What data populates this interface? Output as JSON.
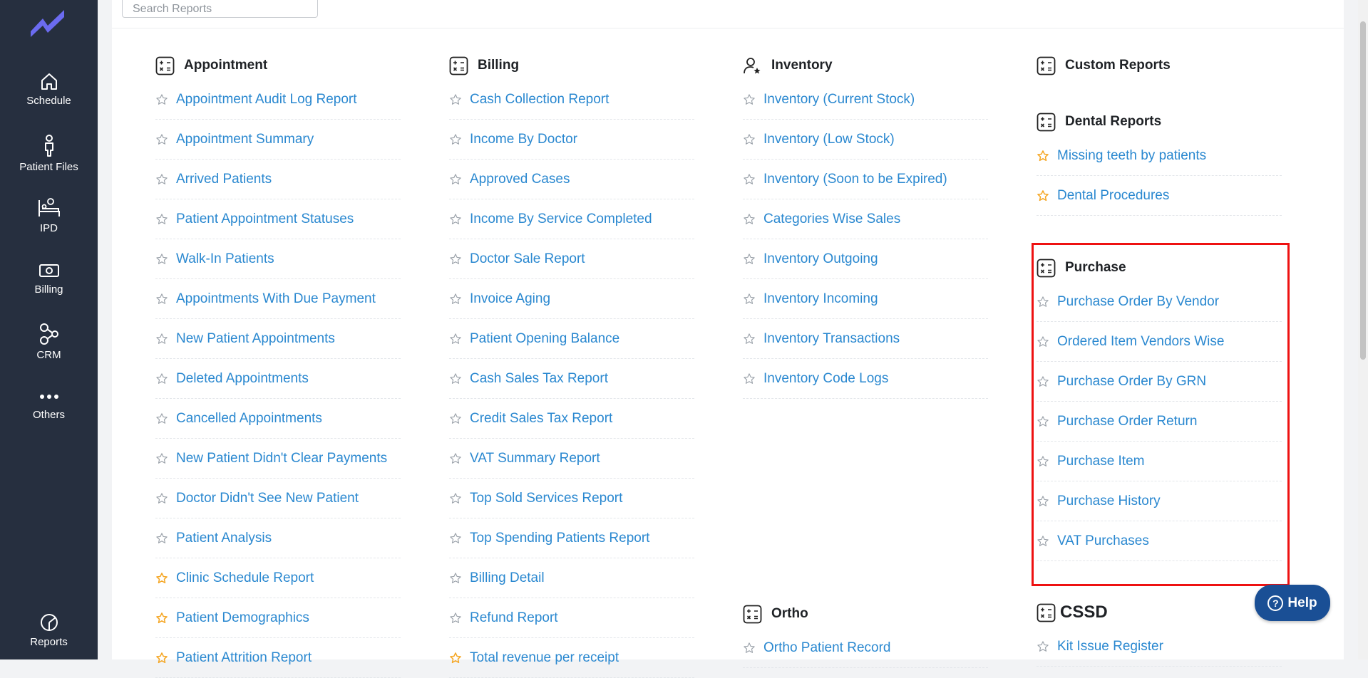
{
  "sidebar": {
    "items": [
      {
        "label": "Schedule",
        "icon": "home-icon"
      },
      {
        "label": "Patient Files",
        "icon": "person-icon"
      },
      {
        "label": "IPD",
        "icon": "bed-icon"
      },
      {
        "label": "Billing",
        "icon": "cash-icon"
      },
      {
        "label": "CRM",
        "icon": "nodes-icon"
      },
      {
        "label": "Others",
        "icon": "dots-icon"
      }
    ],
    "reports_label": "Reports"
  },
  "search": {
    "placeholder": "Search Reports"
  },
  "sections": {
    "appointment": {
      "title": "Appointment",
      "items": [
        {
          "label": "Appointment Audit Log Report",
          "starred": false
        },
        {
          "label": "Appointment Summary",
          "starred": false
        },
        {
          "label": "Arrived Patients",
          "starred": false
        },
        {
          "label": "Patient Appointment Statuses",
          "starred": false
        },
        {
          "label": "Walk-In Patients",
          "starred": false
        },
        {
          "label": "Appointments With Due Payment",
          "starred": false
        },
        {
          "label": "New Patient Appointments",
          "starred": false
        },
        {
          "label": "Deleted Appointments",
          "starred": false
        },
        {
          "label": "Cancelled Appointments",
          "starred": false
        },
        {
          "label": "New Patient Didn't Clear Payments",
          "starred": false
        },
        {
          "label": "Doctor Didn't See New Patient",
          "starred": false
        },
        {
          "label": "Patient Analysis",
          "starred": false
        },
        {
          "label": "Clinic Schedule Report",
          "starred": true
        },
        {
          "label": "Patient Demographics",
          "starred": true
        },
        {
          "label": "Patient Attrition Report",
          "starred": true
        }
      ]
    },
    "billing": {
      "title": "Billing",
      "items": [
        {
          "label": "Cash Collection Report",
          "starred": false
        },
        {
          "label": "Income By Doctor",
          "starred": false
        },
        {
          "label": "Approved Cases",
          "starred": false
        },
        {
          "label": "Income By Service Completed",
          "starred": false
        },
        {
          "label": "Doctor Sale Report",
          "starred": false
        },
        {
          "label": "Invoice Aging",
          "starred": false
        },
        {
          "label": "Patient Opening Balance",
          "starred": false
        },
        {
          "label": "Cash Sales Tax Report",
          "starred": false
        },
        {
          "label": "Credit Sales Tax Report",
          "starred": false
        },
        {
          "label": "VAT Summary Report",
          "starred": false
        },
        {
          "label": "Top Sold Services Report",
          "starred": false
        },
        {
          "label": "Top Spending Patients Report",
          "starred": false
        },
        {
          "label": "Billing Detail",
          "starred": false
        },
        {
          "label": "Refund Report",
          "starred": false
        },
        {
          "label": "Total revenue per receipt",
          "starred": true
        }
      ]
    },
    "inventory": {
      "title": "Inventory",
      "items": [
        {
          "label": "Inventory (Current Stock)",
          "starred": false
        },
        {
          "label": "Inventory (Low Stock)",
          "starred": false
        },
        {
          "label": "Inventory (Soon to be Expired)",
          "starred": false
        },
        {
          "label": "Categories Wise Sales",
          "starred": false
        },
        {
          "label": "Inventory Outgoing",
          "starred": false
        },
        {
          "label": "Inventory Incoming",
          "starred": false
        },
        {
          "label": "Inventory Transactions",
          "starred": false
        },
        {
          "label": "Inventory Code Logs",
          "starred": false
        }
      ]
    },
    "ortho": {
      "title": "Ortho",
      "items": [
        {
          "label": "Ortho Patient Record",
          "starred": false
        }
      ]
    },
    "custom": {
      "title": "Custom Reports"
    },
    "dental": {
      "title": "Dental Reports",
      "items": [
        {
          "label": "Missing teeth by patients",
          "starred": true
        },
        {
          "label": "Dental Procedures",
          "starred": true
        }
      ]
    },
    "purchase": {
      "title": "Purchase",
      "items": [
        {
          "label": "Purchase Order By Vendor",
          "starred": false
        },
        {
          "label": "Ordered Item Vendors Wise",
          "starred": false
        },
        {
          "label": "Purchase Order By GRN",
          "starred": false
        },
        {
          "label": "Purchase Order Return",
          "starred": false
        },
        {
          "label": "Purchase Item",
          "starred": false
        },
        {
          "label": "Purchase History",
          "starred": false
        },
        {
          "label": "VAT Purchases",
          "starred": false
        }
      ]
    },
    "cssd": {
      "title": "CSSD",
      "items": [
        {
          "label": "Kit Issue Register",
          "starred": false
        }
      ]
    }
  },
  "help": {
    "label": "Help",
    "icon_glyph": "?"
  },
  "colors": {
    "sidebar": "#262f3f",
    "link": "#2a88d0",
    "star_on": "#f5a623",
    "star_off": "#9aa1a9",
    "highlight": "#ee1111",
    "help": "#1a4f95"
  }
}
